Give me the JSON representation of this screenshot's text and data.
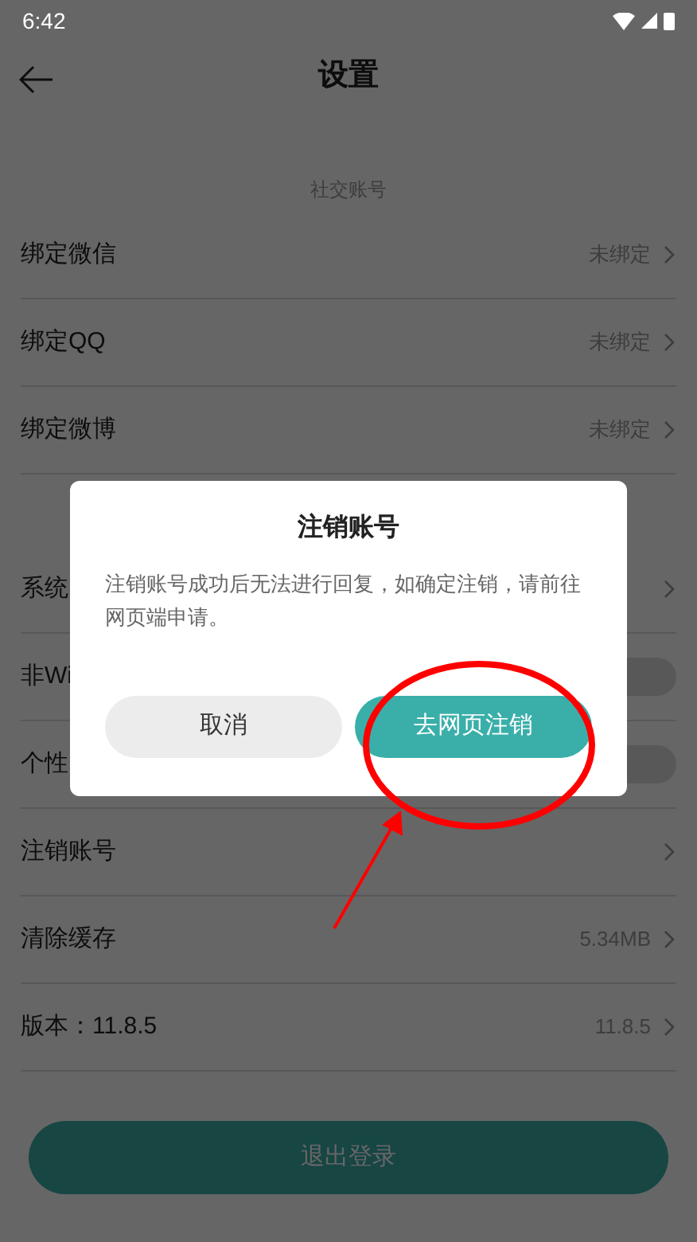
{
  "status_bar": {
    "time": "6:42"
  },
  "header": {
    "title": "设置"
  },
  "sections": [
    {
      "label": "社交账号",
      "rows": [
        {
          "kind": "link",
          "label": "绑定微信",
          "value": "未绑定"
        },
        {
          "kind": "link",
          "label": "绑定QQ",
          "value": "未绑定"
        },
        {
          "kind": "link",
          "label": "绑定微博",
          "value": "未绑定"
        }
      ]
    },
    {
      "rows": [
        {
          "kind": "link",
          "label": "系统"
        },
        {
          "kind": "toggle",
          "label": "非Wi",
          "on": false
        },
        {
          "kind": "toggle",
          "label": "个性",
          "on": false
        },
        {
          "kind": "link",
          "label": "注销账号"
        },
        {
          "kind": "link",
          "label": "清除缓存",
          "value": "5.34MB"
        },
        {
          "kind": "link",
          "label": "版本：11.8.5",
          "value": "11.8.5"
        }
      ]
    }
  ],
  "logout_button": {
    "label": "退出登录"
  },
  "dialog": {
    "title": "注销账号",
    "message": "注销账号成功后无法进行回复，如确定注销，请前往网页端申请。",
    "buttons": [
      {
        "kind": "cancel",
        "label": "取消"
      },
      {
        "kind": "confirm",
        "label": "去网页注销"
      }
    ]
  }
}
